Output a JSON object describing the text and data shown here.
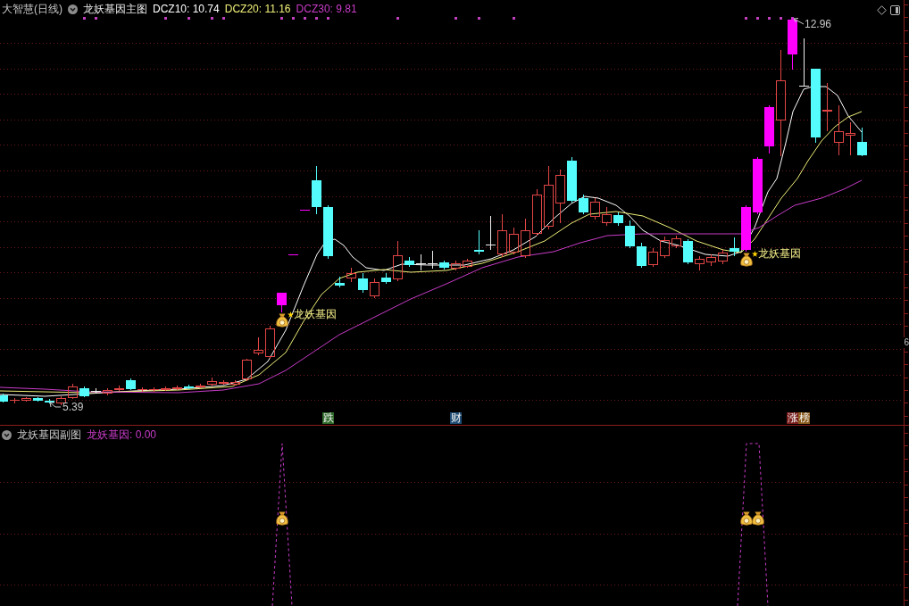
{
  "main_panel": {
    "title": "大智慧(日线)",
    "indicator": "龙妖基因主图",
    "legend": [
      {
        "text": "DCZ10: 10.74",
        "color": "#ffffff"
      },
      {
        "text": "DCZ20: 11.16",
        "color": "#f0f07a"
      },
      {
        "text": "DCZ30: 9.81",
        "color": "#c83cc8"
      }
    ],
    "high_label": "12.96",
    "low_label": "5.39",
    "signals": [
      {
        "text": "龙妖基因"
      },
      {
        "text": "龙妖基因"
      }
    ],
    "event_tags": [
      {
        "text": "跌",
        "color": "#2e6a2a"
      },
      {
        "text": "财",
        "color": "#1f4c74"
      },
      {
        "text": "涨",
        "color": "#7a1c1c"
      },
      {
        "text": "榜",
        "color": "#8a5a1c"
      }
    ],
    "axis_label": "6"
  },
  "sub_panel": {
    "title": "龙妖基因副图",
    "reading": "龙妖基因: 0.00"
  }
}
